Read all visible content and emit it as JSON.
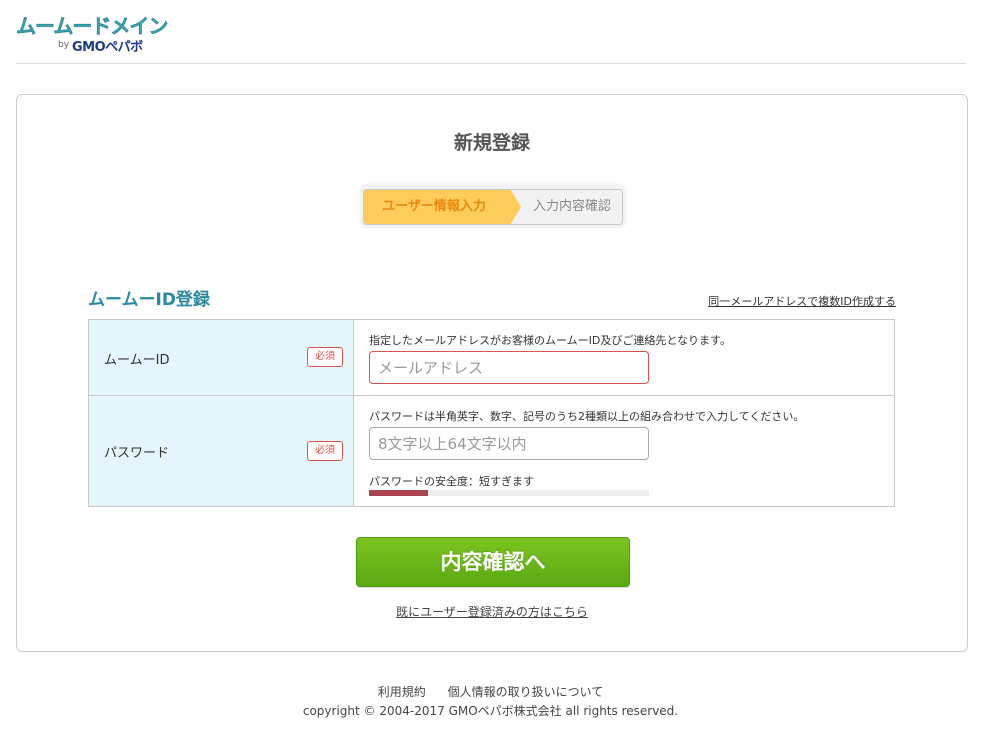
{
  "header": {
    "logo_main": "ムームードメイン",
    "logo_by": "by",
    "logo_sub": "GMOペパボ"
  },
  "main": {
    "title": "新規登録",
    "steps": [
      "ユーザー情報入力",
      "入力内容確認"
    ],
    "section_title": "ムームーID登録",
    "multi_id_link": "同一メールアドレスで複数ID作成する",
    "form": {
      "id_row": {
        "label": "ムームーID",
        "required": "必須",
        "hint": "指定したメールアドレスがお客様のムームーID及びご連絡先となります。",
        "placeholder": "メールアドレス",
        "value": ""
      },
      "password_row": {
        "label": "パスワード",
        "required": "必須",
        "hint": "パスワードは半角英字、数字、記号のうち2種類以上の組み合わせで入力してください。",
        "placeholder": "8文字以上64文字以内",
        "value": "",
        "strength_text": "パスワードの安全度：短すぎます",
        "strength_level": 0.21,
        "strength_color": "#a94450"
      }
    },
    "submit_label": "内容確認へ",
    "login_link": "既にユーザー登録済みの方はこちら"
  },
  "footer": {
    "links": [
      "利用規約",
      "個人情報の取り扱いについて"
    ],
    "copyright": "copyright © 2004-2017 GMOペパボ株式会社 all rights reserved."
  },
  "colors": {
    "accent": "#2a8a9f",
    "step_active_bg": "#fdcc5a",
    "step_active_text": "#e88a10",
    "button_green": "#6cb81a",
    "required_red": "#d9534f",
    "label_bg": "#e4f5fb"
  }
}
